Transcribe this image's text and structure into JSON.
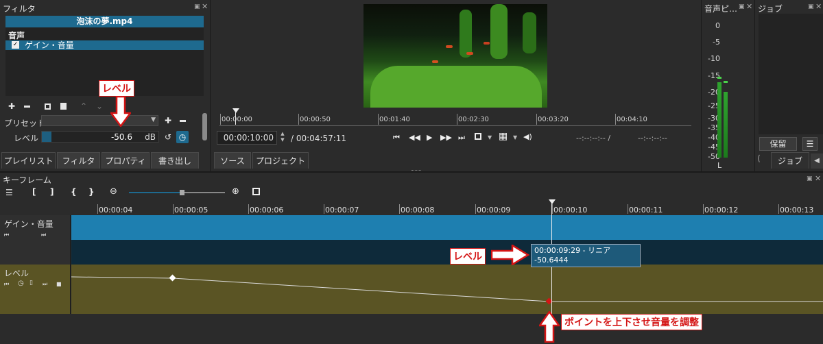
{
  "filter_panel": {
    "title": "フィルタ",
    "clip_name": "泡沫の夢.mp4",
    "category": "音声",
    "item": "ゲイン・音量",
    "check_mark": "✓",
    "preset_label": "プリセット",
    "level_label": "レベル",
    "level_value": "-50.6",
    "level_unit": "dB",
    "level_fill": 0.08
  },
  "tabs_left": [
    "プレイリスト",
    "フィルタ",
    "プロパティ",
    "書き出し"
  ],
  "tabs_mid": [
    "ソース",
    "プロジェクト"
  ],
  "player": {
    "ruler": [
      "00:00:00",
      "00:00:50",
      "00:01:40",
      "00:02:30",
      "00:03:20",
      "00:04:10"
    ],
    "current_time": "00:00:10:00",
    "total_time": "/ 00:04:57:11",
    "in_point": "--:--:--:-- /",
    "out_point": "--:--:--:--"
  },
  "meter": {
    "title": "音声ピ…",
    "scale": [
      "0",
      "-5",
      "-10",
      "-15",
      "-20",
      "-25",
      "-30",
      "-35",
      "-40",
      "-45",
      "-50"
    ],
    "channel": "L",
    "left_level": 0.55,
    "right_level": 0.48
  },
  "jobs": {
    "title": "ジョブ",
    "pause_label": "保留",
    "tab_label": "ジョブ"
  },
  "keyframes": {
    "title": "キーフレーム",
    "times": [
      "00:00:04",
      "00:00:05",
      "00:00:06",
      "00:00:07",
      "00:00:08",
      "00:00:09",
      "00:00:10",
      "00:00:11",
      "00:00:12",
      "00:00:13"
    ],
    "track1_name": "ゲイン・音量",
    "track2_name": "レベル",
    "tooltip_line1": "00:00:09:29 - リニア",
    "tooltip_line2": "-50.6444"
  },
  "annotations": {
    "top": "レベル",
    "mid": "レベル",
    "bottom": "ポイントを上下させ音量を調整",
    "color": "#d41414"
  }
}
